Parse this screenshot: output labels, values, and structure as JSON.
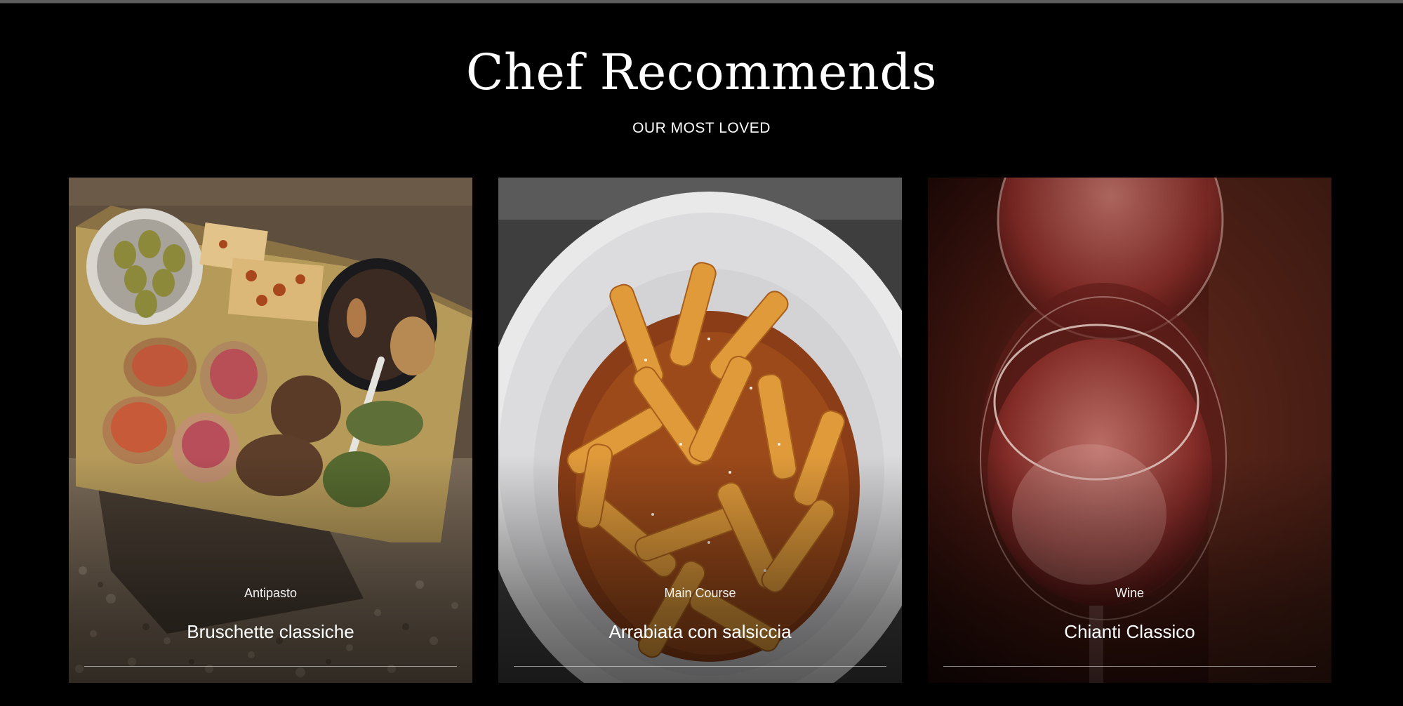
{
  "section": {
    "title": "Chef Recommends",
    "subtitle": "OUR MOST LOVED"
  },
  "cards": [
    {
      "category": "Antipasto",
      "name": "Bruschette classiche"
    },
    {
      "category": "Main Course",
      "name": "Arrabiata con salsiccia"
    },
    {
      "category": "Wine",
      "name": "Chianti Classico"
    }
  ]
}
